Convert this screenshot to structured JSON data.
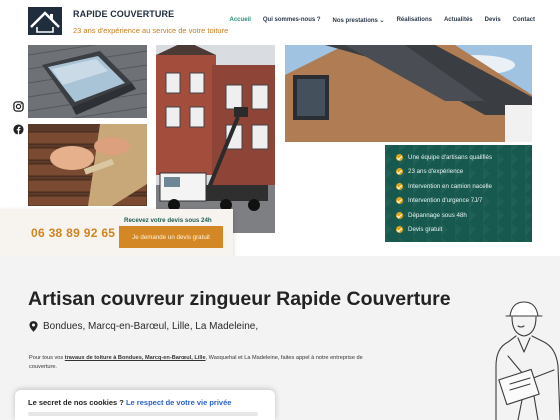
{
  "header": {
    "brand": "RAPIDE COUVERTURE",
    "tagline": "23 ans d'expérience au service de votre toiture",
    "nav": [
      {
        "label": "Accueil",
        "active": true
      },
      {
        "label": "Qui sommes-nous ?",
        "active": false
      },
      {
        "label": "Nos prestations ⌄",
        "active": false
      },
      {
        "label": "Réalisations",
        "active": false
      },
      {
        "label": "Actualités",
        "active": false
      },
      {
        "label": "Devis",
        "active": false
      },
      {
        "label": "Contact",
        "active": false
      }
    ]
  },
  "social": {
    "instagram_icon": "instagram-icon",
    "facebook_icon": "facebook-icon"
  },
  "features": {
    "items": [
      "Une équipe d'artisans qualifiés",
      "23 ans d'expérience",
      "Intervention en camion nacelle",
      "Intervention d'urgence 7J/7",
      "Dépannage sous 48h",
      "Devis gratuit"
    ]
  },
  "cta": {
    "phone": "06 38 89 92 65",
    "heading": "Recevez votre devis sous 24h",
    "button": "Je demande un devis gratuit"
  },
  "main": {
    "title": "Artisan couvreur zingueur Rapide Couverture",
    "locations": "Bondues, Marcq-en-Barœul, Lille, La Madeleine,",
    "intro_prefix": "Pour tous vos ",
    "intro_link": "travaux de toiture à Bondues, Marcq-en-Barœul, Lille",
    "intro_suffix": ", Wasquehal et La Madeleine, faites appel à notre entreprise de couverture."
  },
  "cookie": {
    "title": "Le secret de nos cookies ?",
    "link": "Le respect de votre vie privée"
  },
  "colors": {
    "accent_orange": "#d48825",
    "accent_teal": "#17594f",
    "nav_active": "#2e8d7a",
    "brand_dark": "#1f2d3d"
  }
}
